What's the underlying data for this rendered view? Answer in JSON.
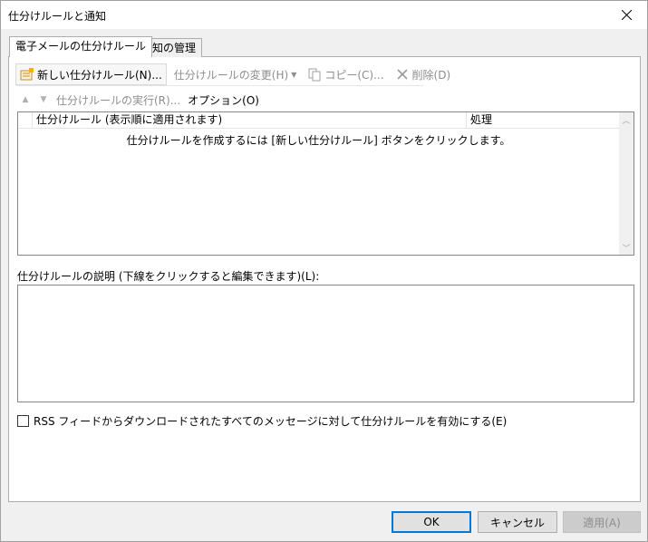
{
  "window": {
    "title": "仕分けルールと通知"
  },
  "tabs": [
    {
      "label": "電子メールの仕分けルール",
      "active": true
    },
    {
      "label": "通知の管理",
      "active": false
    }
  ],
  "toolbar": {
    "new_rule": "新しい仕分けルール(N)...",
    "change_rule": "仕分けルールの変更(H)",
    "copy": "コピー(C)...",
    "delete": "削除(D)"
  },
  "toolbar2": {
    "run_rules": "仕分けルールの実行(R)...",
    "options": "オプション(O)"
  },
  "rules_list": {
    "columns": [
      "仕分けルール (表示順に適用されます)",
      "処理"
    ],
    "empty_message": "仕分けルールを作成するには [新しい仕分けルール] ボタンをクリックします。"
  },
  "description": {
    "label": "仕分けルールの説明 (下線をクリックすると編集できます)(L):"
  },
  "rss_checkbox": {
    "label": "RSS フィードからダウンロードされたすべてのメッセージに対して仕分けルールを有効にする(E)",
    "checked": false
  },
  "buttons": {
    "ok": "OK",
    "cancel": "キャンセル",
    "apply": "適用(A)"
  },
  "colors": {
    "focus_border": "#0078d7",
    "disabled_text": "#8d8d8d"
  }
}
